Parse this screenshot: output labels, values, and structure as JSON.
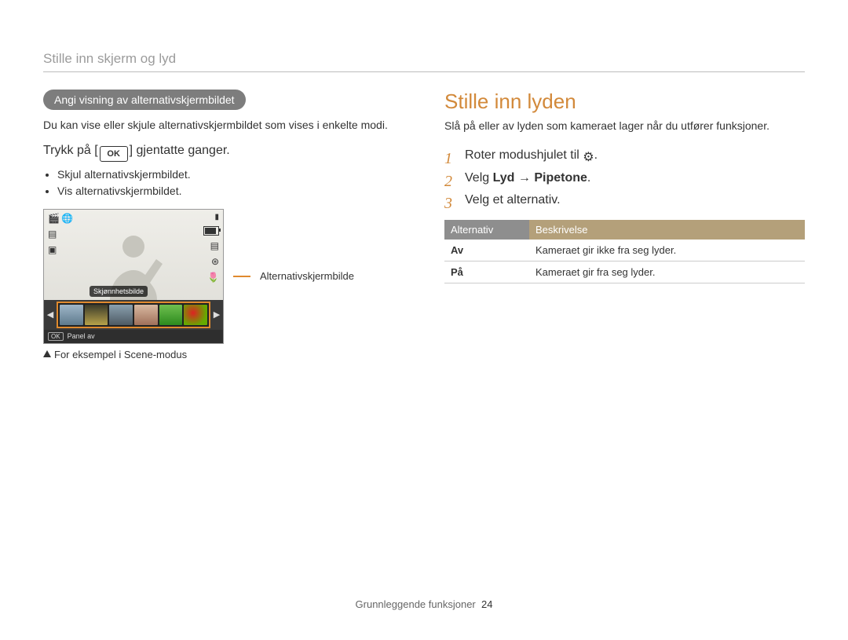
{
  "breadcrumb": "Stille inn skjerm og lyd",
  "left": {
    "pill": "Angi visning av alternativskjermbildet",
    "intro": "Du kan vise eller skjule alternativskjermbildet som vises i enkelte modi.",
    "press_prefix": "Trykk på [",
    "ok_label": "OK",
    "press_suffix": "] gjentatte ganger.",
    "bullets": [
      "Skjul alternativskjermbildet.",
      "Vis alternativskjermbildet."
    ],
    "camera": {
      "badge": "Skjønnhetsbilde",
      "panel_ok": "OK",
      "panel_text": "Panel av"
    },
    "callout": "Alternativskjermbilde",
    "caption": "For eksempel i Scene-modus"
  },
  "right": {
    "heading": "Stille inn lyden",
    "intro": "Slå på eller av lyden som kameraet lager når du utfører funksjoner.",
    "steps": [
      {
        "num": "1",
        "prefix": "Roter modushjulet til ",
        "icon": "gear",
        "suffix": "."
      },
      {
        "num": "2",
        "prefix": "Velg ",
        "bold1": "Lyd",
        "arrow": " → ",
        "bold2": "Pipetone",
        "suffix": "."
      },
      {
        "num": "3",
        "prefix": "Velg et alternativ.",
        "bold1": "",
        "arrow": "",
        "bold2": "",
        "suffix": ""
      }
    ],
    "table": {
      "h1": "Alternativ",
      "h2": "Beskrivelse",
      "rows": [
        {
          "k": "Av",
          "v": "Kameraet gir ikke fra seg lyder."
        },
        {
          "k": "På",
          "v": "Kameraet gir fra seg lyder."
        }
      ]
    }
  },
  "footer": {
    "section": "Grunnleggende funksjoner",
    "page": "24"
  }
}
